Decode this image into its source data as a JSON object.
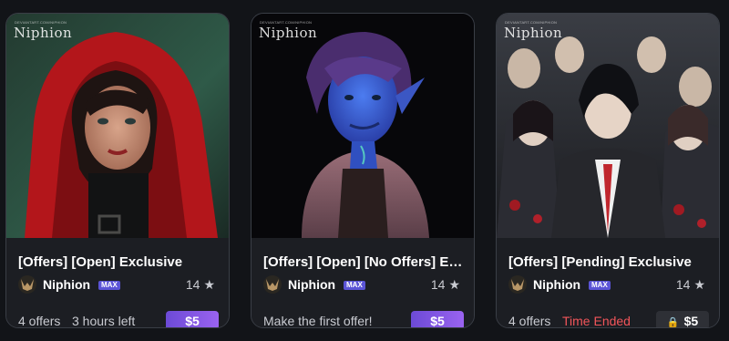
{
  "cards": [
    {
      "watermark": "Niphion",
      "watermark_sub": "DEVIANTART.COM/NIPHION",
      "title": "[Offers] [Open] Exclusive",
      "author": "Niphion",
      "badge": "MAX",
      "favorites": "14",
      "offers": "4 offers",
      "time": "3 hours left",
      "price": "$5",
      "image": "red-hood-portrait"
    },
    {
      "watermark": "Niphion",
      "watermark_sub": "DEVIANTART.COM/NIPHION",
      "title": "[Offers] [Open] [No Offers] Ex...",
      "author": "Niphion",
      "badge": "MAX",
      "favorites": "14",
      "first_offer": "Make the first offer!",
      "price": "$5",
      "image": "blue-elf-portrait"
    },
    {
      "watermark": "Niphion",
      "watermark_sub": "DEVIANTART.COM/NIPHION",
      "title": "[Offers] [Pending] Exclusive",
      "author": "Niphion",
      "badge": "MAX",
      "favorites": "14",
      "offers": "4 offers",
      "time": "Time Ended",
      "price": "$5",
      "image": "school-group-portrait"
    }
  ],
  "colors": {
    "page_bg": "#121418",
    "card_bg": "#1c1e23",
    "price_gradient_start": "#6c4ad6",
    "price_gradient_end": "#9a63f0",
    "ended_red": "#f2555a",
    "badge": "#5b54d6"
  },
  "icons": {
    "star": "star-icon",
    "lock": "lock-icon",
    "avatar": "avatar-icon"
  }
}
